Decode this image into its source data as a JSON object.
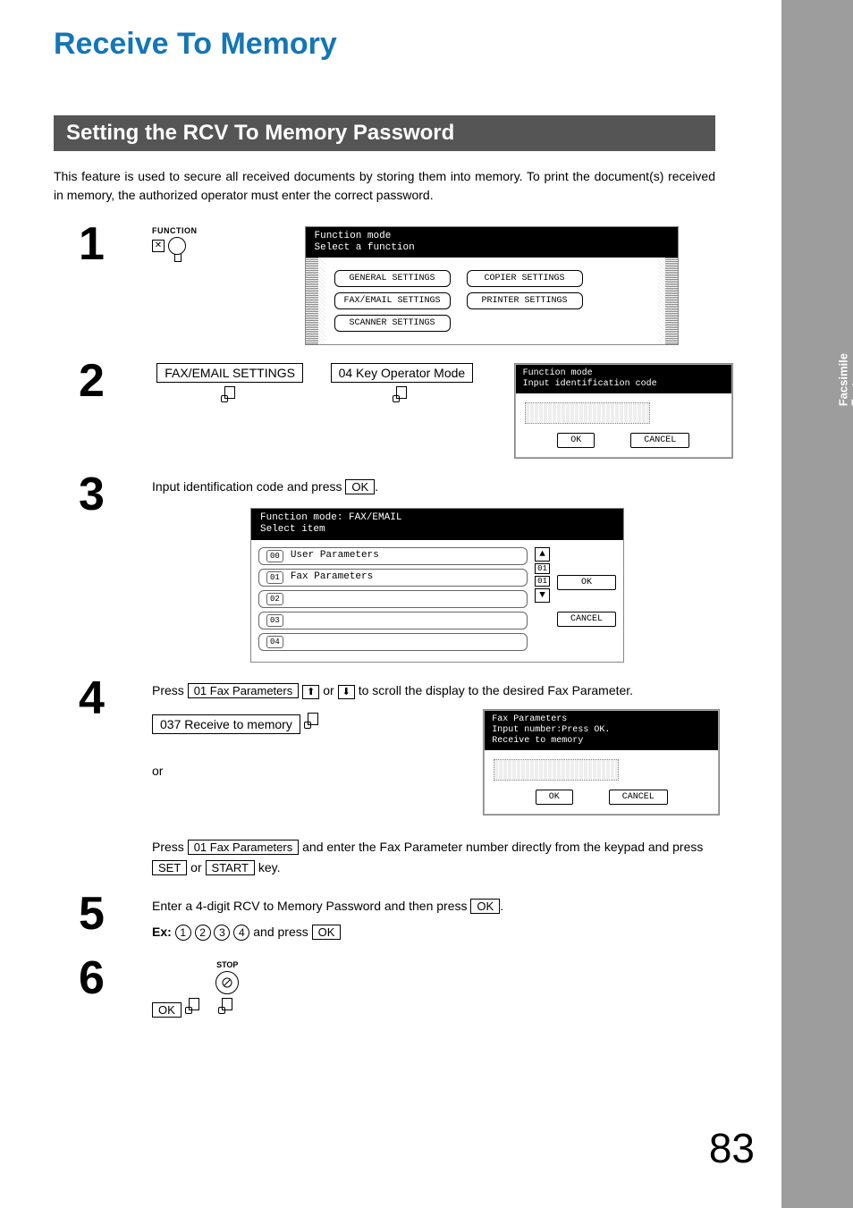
{
  "title": "Receive To Memory",
  "section": "Setting the RCV To Memory Password",
  "intro": "This feature is used to secure all received documents by storing them into memory.  To print the document(s) received in memory, the authorized operator must enter the correct password.",
  "side_tab": "Facsimile\nFeatures",
  "page_number": "83",
  "step1": {
    "num": "1",
    "key_label": "FUNCTION",
    "lcd_title1": "Function mode",
    "lcd_title2": "Select a function",
    "buttons": {
      "general": "GENERAL SETTINGS",
      "copier": "COPIER SETTINGS",
      "faxemail": "FAX/EMAIL SETTINGS",
      "printer": "PRINTER SETTINGS",
      "scanner": "SCANNER SETTINGS"
    }
  },
  "step2": {
    "num": "2",
    "btn1": "FAX/EMAIL SETTINGS",
    "btn2": "04 Key Operator Mode",
    "dlg_title1": "Function mode",
    "dlg_title2": "Input identification code",
    "ok": "OK",
    "cancel": "CANCEL"
  },
  "step3": {
    "num": "3",
    "text_before": "Input identification code and press ",
    "ok_box": "OK",
    "text_after": ".",
    "lcd_title1": "Function mode: FAX/EMAIL",
    "lcd_title2": "Select item",
    "items": [
      {
        "n": "00",
        "label": "User Parameters"
      },
      {
        "n": "01",
        "label": "Fax Parameters"
      },
      {
        "n": "02",
        "label": ""
      },
      {
        "n": "03",
        "label": ""
      },
      {
        "n": "04",
        "label": ""
      }
    ],
    "scroll_top": "01",
    "scroll_bot": "01",
    "ok": "OK",
    "cancel": "CANCEL"
  },
  "step4": {
    "num": "4",
    "press": "Press ",
    "fax_params": "01 Fax Parameters",
    "scroll_txt": " to scroll the display to the desired Fax Parameter.",
    "recv_btn": "037 Receive to memory",
    "or": "or",
    "alt_press": "Press ",
    "alt_mid": " and enter the Fax Parameter number directly from the keypad and press ",
    "set": "SET",
    "or2": " or ",
    "start": "START",
    "key_txt": " key.",
    "dlg_t1": "Fax Parameters",
    "dlg_t2": "Input number:Press OK.",
    "dlg_t3": "Receive to memory",
    "ok": "OK",
    "cancel": "CANCEL"
  },
  "step5": {
    "num": "5",
    "line": "Enter a 4-digit RCV to Memory Password and then press ",
    "ok_box": "OK",
    "dot": ".",
    "ex": "Ex:",
    "d1": "1",
    "d2": "2",
    "d3": "3",
    "d4": "4",
    "and_press": " and press ",
    "ok_box2": "OK"
  },
  "step6": {
    "num": "6",
    "ok": "OK",
    "stop": "STOP"
  }
}
